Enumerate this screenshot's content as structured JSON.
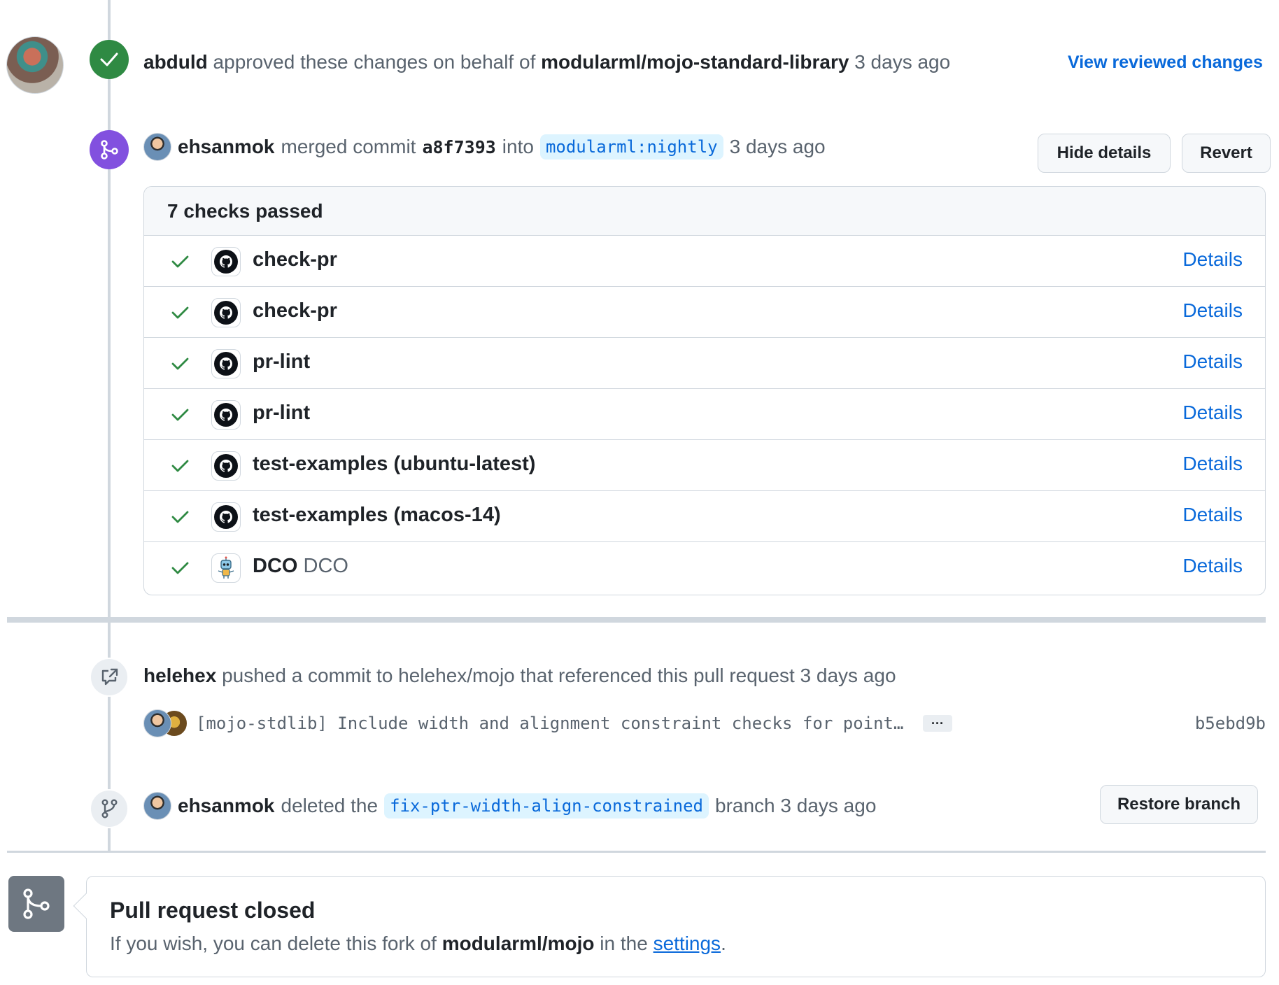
{
  "approval": {
    "user": "abduld",
    "text": "approved these changes on behalf of",
    "org": "modularml/mojo-standard-library",
    "time": "3 days ago",
    "view_link": "View reviewed changes"
  },
  "merge": {
    "user": "ehsanmok",
    "text_merged": "merged commit",
    "commit": "a8f7393",
    "text_into": "into",
    "branch": "modularml:nightly",
    "time": "3 days ago",
    "hide_details": "Hide details",
    "revert": "Revert"
  },
  "checks": {
    "header": "7 checks passed",
    "details_label": "Details",
    "items": [
      {
        "name": "check-pr",
        "desc": "",
        "icon": "github-icon"
      },
      {
        "name": "check-pr",
        "desc": "",
        "icon": "github-icon"
      },
      {
        "name": "pr-lint",
        "desc": "",
        "icon": "github-icon"
      },
      {
        "name": "pr-lint",
        "desc": "",
        "icon": "github-icon"
      },
      {
        "name": "test-examples (ubuntu-latest)",
        "desc": "",
        "icon": "github-icon"
      },
      {
        "name": "test-examples (macos-14)",
        "desc": "",
        "icon": "github-icon"
      },
      {
        "name": "DCO",
        "desc": "DCO",
        "icon": "dco-robot-icon"
      }
    ]
  },
  "push": {
    "user": "helehex",
    "text": "pushed a commit to helehex/mojo that referenced this pull request 3 days ago",
    "commit_message": "[mojo-stdlib] Include width and alignment constraint checks for point…",
    "ellipsis": "···",
    "sha": "b5ebd9b"
  },
  "delete": {
    "user": "ehsanmok",
    "text_deleted": "deleted the",
    "branch": "fix-ptr-width-align-constrained",
    "text_branch": "branch 3 days ago",
    "restore": "Restore branch"
  },
  "closed": {
    "title": "Pull request closed",
    "sub_before": "If you wish, you can delete this fork of",
    "repo": "modularml/mojo",
    "sub_middle": "in the",
    "settings_link": "settings",
    "sub_after": "."
  },
  "colors": {
    "success": "#2f8a43",
    "merged": "#8250df",
    "link": "#0969da",
    "muted": "#59636e",
    "border": "#d0d7de"
  }
}
